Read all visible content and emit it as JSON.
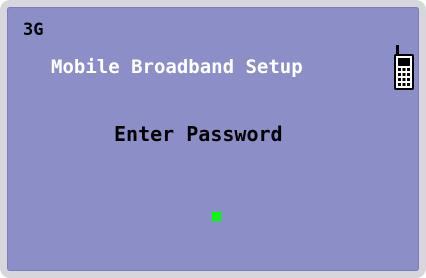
{
  "status": {
    "network": "3G"
  },
  "header": {
    "title": "Mobile Broadband Setup",
    "icon": "mobile-phone-icon"
  },
  "main": {
    "prompt": "Enter Password",
    "password_value": ""
  },
  "colors": {
    "screen": "#8c8ec7",
    "title": "#ffffff",
    "text": "#000000",
    "cursor": "#00ff00"
  }
}
